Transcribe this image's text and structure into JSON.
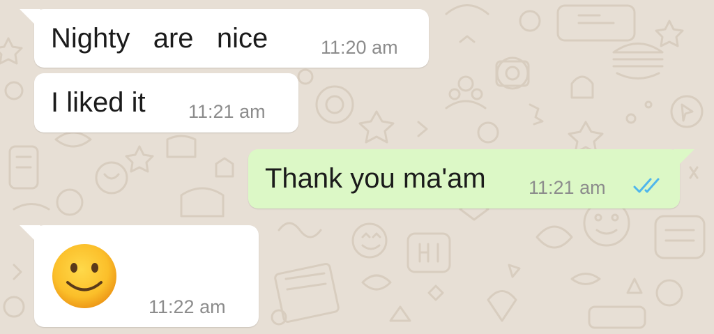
{
  "colors": {
    "wallpaper": "#e7dfd5",
    "incoming_bubble": "#ffffff",
    "outgoing_bubble": "#dcf8c6",
    "time_text": "#8c8c8c",
    "read_ticks": "#4fb6ec"
  },
  "messages": [
    {
      "direction": "incoming",
      "text": "Nighty   are   nice",
      "time": "11:20 am"
    },
    {
      "direction": "incoming",
      "text": "I liked it",
      "time": "11:21 am"
    },
    {
      "direction": "outgoing",
      "text": "Thank you ma'am",
      "time": "11:21 am",
      "status_icon": "double-check-read-icon"
    },
    {
      "direction": "incoming",
      "emoji": "slightly-smiling-face-emoji",
      "time": "11:22 am"
    }
  ]
}
